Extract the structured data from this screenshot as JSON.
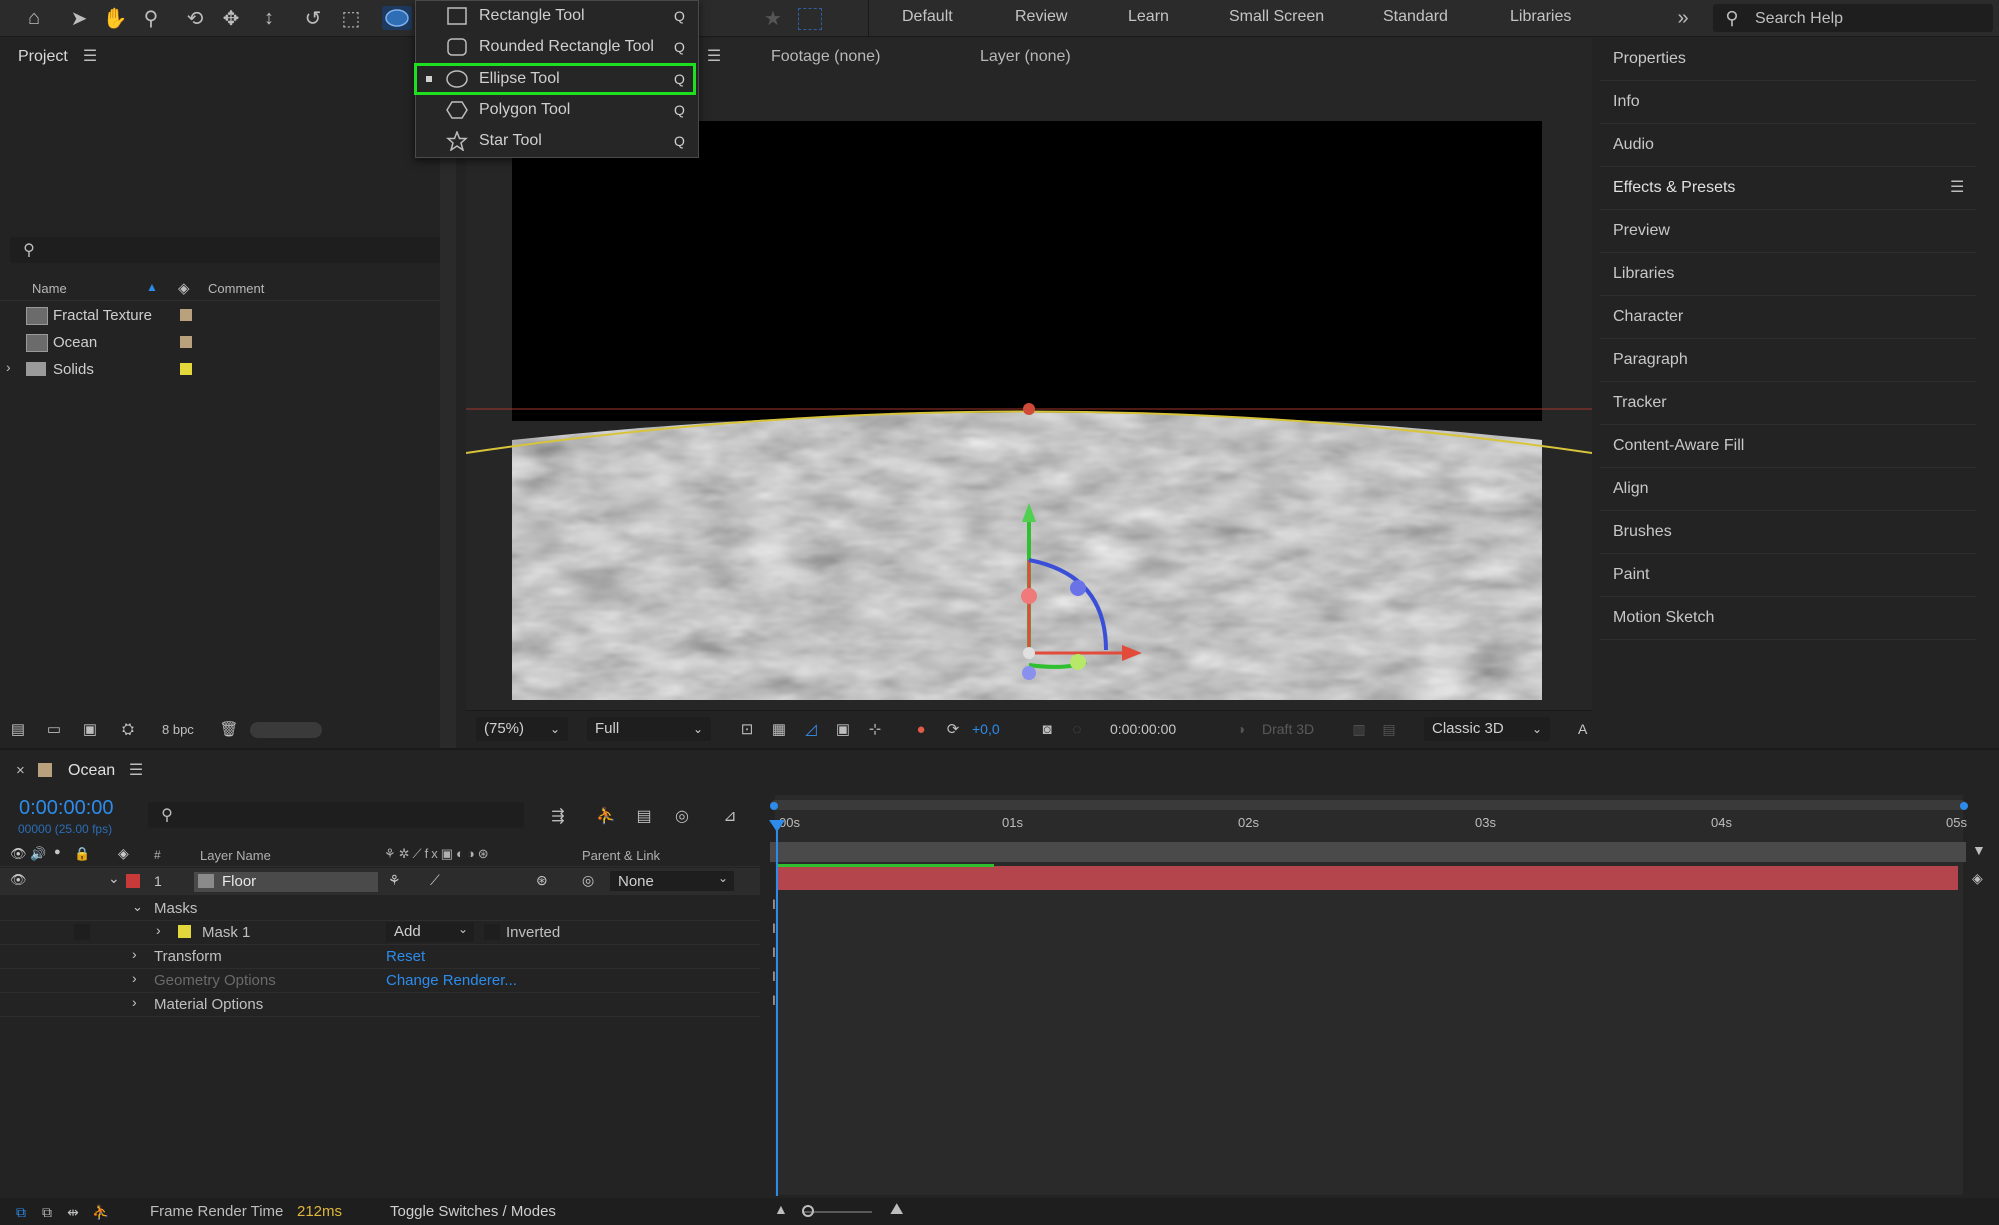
{
  "toolbar": {
    "workspaces": [
      "Default",
      "Review",
      "Learn",
      "Small Screen",
      "Standard",
      "Libraries"
    ],
    "search_placeholder": "Search Help"
  },
  "tool_menu": {
    "items": [
      {
        "label": "Rectangle Tool",
        "key": "Q"
      },
      {
        "label": "Rounded Rectangle Tool",
        "key": "Q"
      },
      {
        "label": "Ellipse Tool",
        "key": "Q",
        "selected": true
      },
      {
        "label": "Polygon Tool",
        "key": "Q"
      },
      {
        "label": "Star Tool",
        "key": "Q"
      }
    ]
  },
  "project": {
    "title": "Project",
    "col_name": "Name",
    "col_comment": "Comment",
    "items": [
      {
        "name": "Fractal Texture",
        "label_color": "#b9a17e"
      },
      {
        "name": "Ocean",
        "label_color": "#b9a17e"
      },
      {
        "name": "Solids",
        "label_color": "#e3d83b"
      }
    ],
    "bpc": "8 bpc"
  },
  "viewer": {
    "footage_tab": "Footage (none)",
    "layer_tab": "Layer (none)",
    "zoom": "(75%)",
    "resolution": "Full",
    "exposure": "+0,0",
    "timecode": "0:00:00:00",
    "draft3d": "Draft 3D",
    "renderer": "Classic 3D",
    "extra": "A"
  },
  "right_panel": {
    "items": [
      "Properties",
      "Info",
      "Audio",
      "Effects & Presets",
      "Preview",
      "Libraries",
      "Character",
      "Paragraph",
      "Tracker",
      "Content-Aware Fill",
      "Align",
      "Brushes",
      "Paint",
      "Motion Sketch"
    ]
  },
  "timeline": {
    "comp_name": "Ocean",
    "timecode": "0:00:00:00",
    "frame_info": "00000 (25.00 fps)",
    "col_num": "#",
    "col_layer_name": "Layer Name",
    "col_parent": "Parent & Link",
    "ruler": [
      "00s",
      "01s",
      "02s",
      "03s",
      "04s",
      "05s"
    ],
    "layer": {
      "num": "1",
      "name": "Floor",
      "parent": "None",
      "label_color": "#c83a3a"
    },
    "masks_label": "Masks",
    "mask1": {
      "name": "Mask 1",
      "mode": "Add",
      "inverted": "Inverted"
    },
    "transform": {
      "label": "Transform",
      "action": "Reset"
    },
    "geometry": {
      "label": "Geometry Options",
      "action": "Change Renderer..."
    },
    "material": {
      "label": "Material Options"
    }
  },
  "statusbar": {
    "frame_render_label": "Frame Render Time",
    "frame_render_value": "212ms",
    "toggle": "Toggle Switches / Modes"
  }
}
